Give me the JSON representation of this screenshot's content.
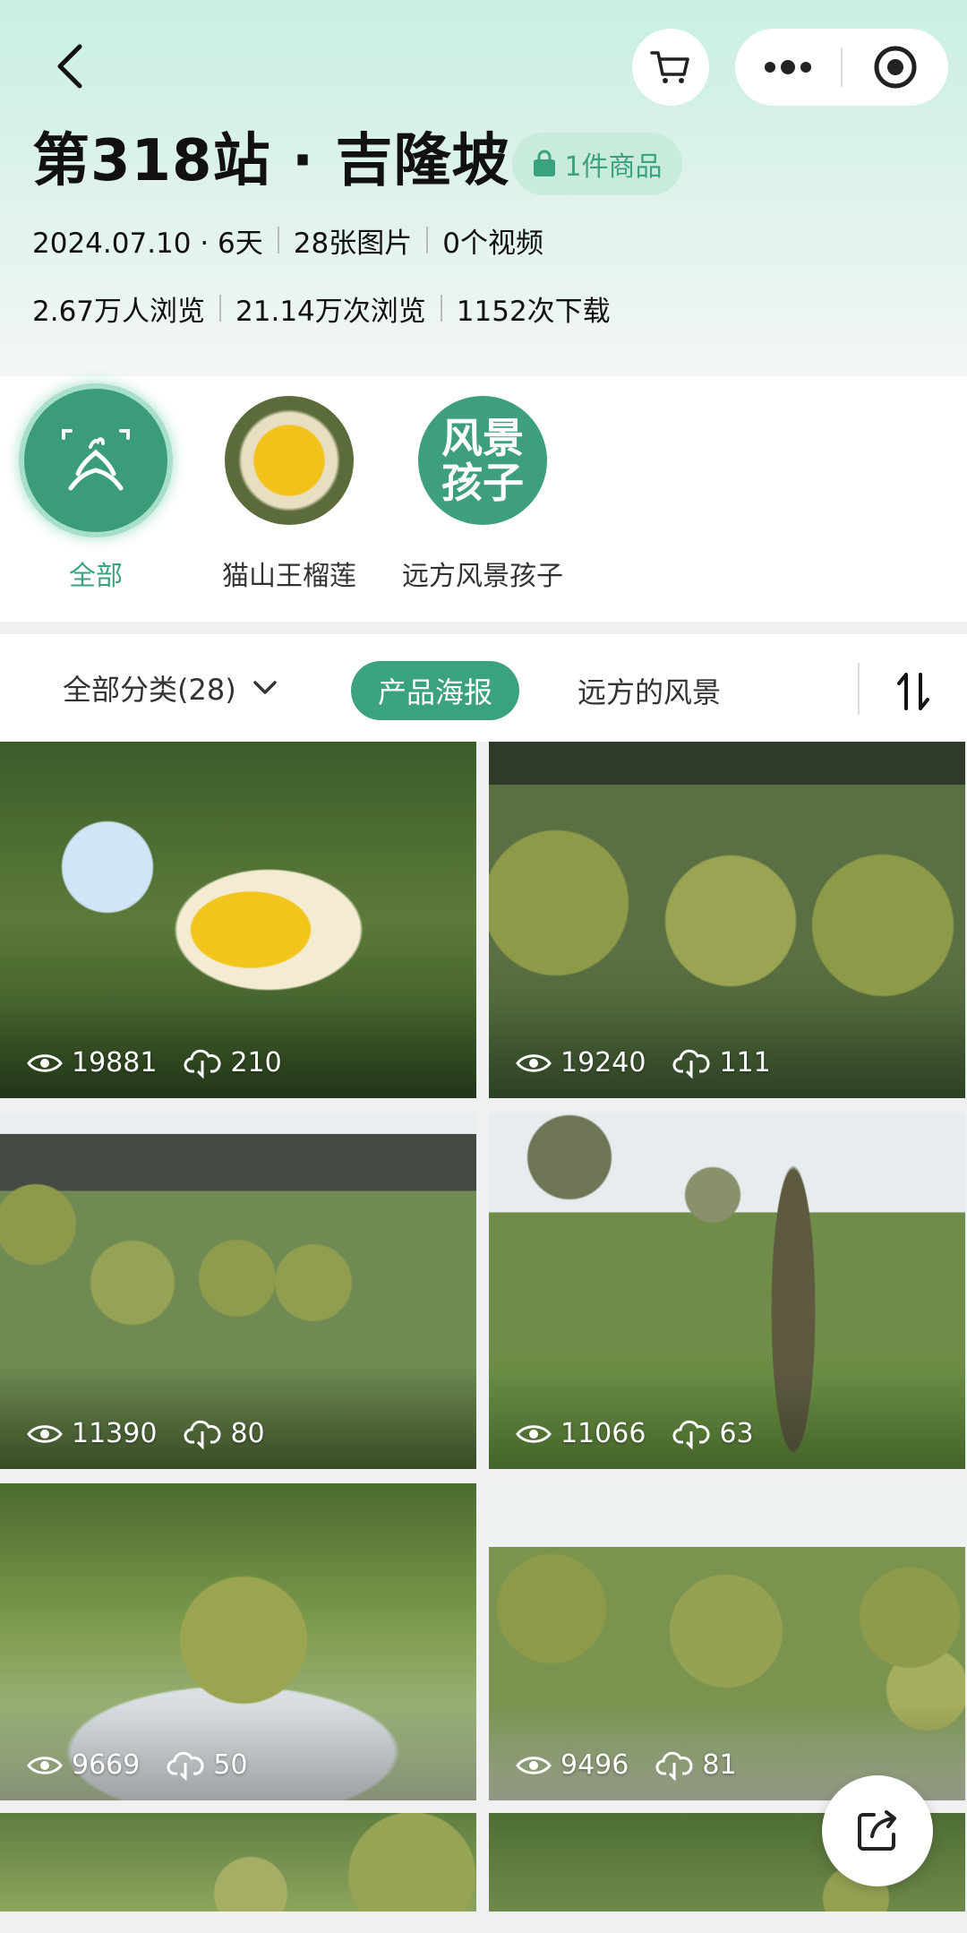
{
  "header": {
    "title": "第318站 · 吉隆坡",
    "goods_badge": "1件商品",
    "date": "2024.07.10 · 6天",
    "images": "28张图片",
    "videos": "0个视频",
    "visitors": "2.67万人浏览",
    "views": "21.14万次浏览",
    "downloads": "1152次下载"
  },
  "albums": [
    {
      "label": "全部",
      "icon": "scenery-logo-icon",
      "active": true
    },
    {
      "label": "猫山王榴莲",
      "icon": "durian-thumbnail"
    },
    {
      "label": "远方风景孩子",
      "icon": "brand-logo",
      "logo_text": "风景孩子"
    }
  ],
  "filter": {
    "category": "全部分类(28)",
    "tabs": [
      {
        "label": "产品海报",
        "active": true
      },
      {
        "label": "远方的风景",
        "active": false
      }
    ]
  },
  "photos": [
    {
      "views": "19881",
      "downloads": "210"
    },
    {
      "views": "19240",
      "downloads": "111"
    },
    {
      "views": "11390",
      "downloads": "80"
    },
    {
      "views": "11066",
      "downloads": "63"
    },
    {
      "views": "9669",
      "downloads": "50"
    },
    {
      "views": "9496",
      "downloads": "81"
    }
  ],
  "colors": {
    "accent": "#3aa37e",
    "badge_bg": "#c8ebdc",
    "header_gradient_top": "#c9efe2"
  }
}
